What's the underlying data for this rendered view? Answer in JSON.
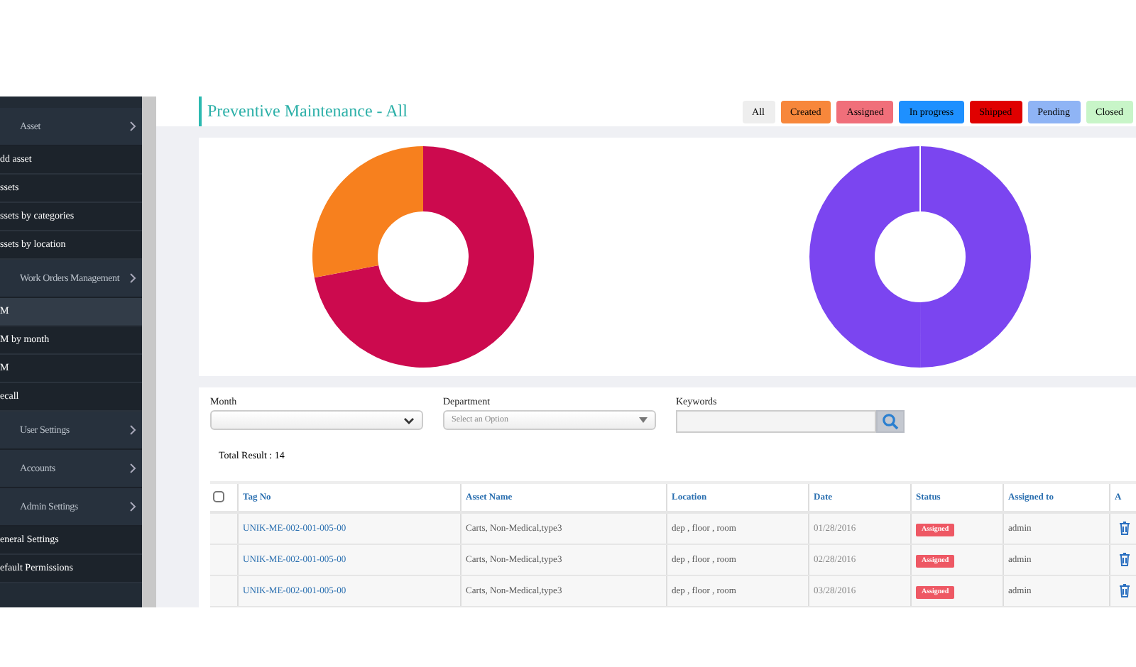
{
  "sidebar": {
    "items": [
      {
        "label": "Asset",
        "children": [
          {
            "label": "dd asset",
            "selected": false
          },
          {
            "label": "ssets",
            "selected": false
          },
          {
            "label": "ssets by categories",
            "selected": false
          },
          {
            "label": "ssets by location",
            "selected": false
          }
        ]
      },
      {
        "label": "Work Orders Management",
        "children": [
          {
            "label": "M",
            "selected": true
          },
          {
            "label": "M by month",
            "selected": false
          },
          {
            "label": "M",
            "selected": false
          },
          {
            "label": "ecall",
            "selected": false
          }
        ]
      },
      {
        "label": "User Settings"
      },
      {
        "label": "Accounts"
      },
      {
        "label": "Admin Settings",
        "children": [
          {
            "label": "eneral Settings",
            "selected": false
          },
          {
            "label": "efault Permissions",
            "selected": false
          }
        ]
      }
    ]
  },
  "page_title": "Preventive Maintenance - All",
  "status_filters": [
    {
      "label": "All",
      "color": "#eeeeee"
    },
    {
      "label": "Created",
      "color": "#f7873b"
    },
    {
      "label": "Assigned",
      "color": "#f06f7a"
    },
    {
      "label": "In progress",
      "color": "#1e90ff"
    },
    {
      "label": "Shipped",
      "color": "#e00000"
    },
    {
      "label": "Pending",
      "color": "#8fb4f5"
    },
    {
      "label": "Closed",
      "color": "#c8f5c8"
    }
  ],
  "filters": {
    "month": {
      "label": "Month"
    },
    "department": {
      "label": "Department",
      "placeholder": "Select an Option"
    },
    "keywords": {
      "label": "Keywords"
    }
  },
  "total_result": "Total Result : 14",
  "table": {
    "select_all": {
      "checked": false
    },
    "columns": [
      "Tag No",
      "Asset Name",
      "Location",
      "Date",
      "Status",
      "Assigned to",
      "A"
    ],
    "rows": [
      {
        "tag_no": "UNIK-ME-002-001-005-00",
        "asset_name": "Carts, Non-Medical,type3",
        "location": "dep , floor , room",
        "date": "01/28/2016",
        "status": "Assigned",
        "assigned_to": "admin"
      },
      {
        "tag_no": "UNIK-ME-002-001-005-00",
        "asset_name": "Carts, Non-Medical,type3",
        "location": "dep , floor , room",
        "date": "02/28/2016",
        "status": "Assigned",
        "assigned_to": "admin"
      },
      {
        "tag_no": "UNIK-ME-002-001-005-00",
        "asset_name": "Carts, Non-Medical,type3",
        "location": "dep , floor , room",
        "date": "03/28/2016",
        "status": "Assigned",
        "assigned_to": "admin"
      }
    ]
  }
}
